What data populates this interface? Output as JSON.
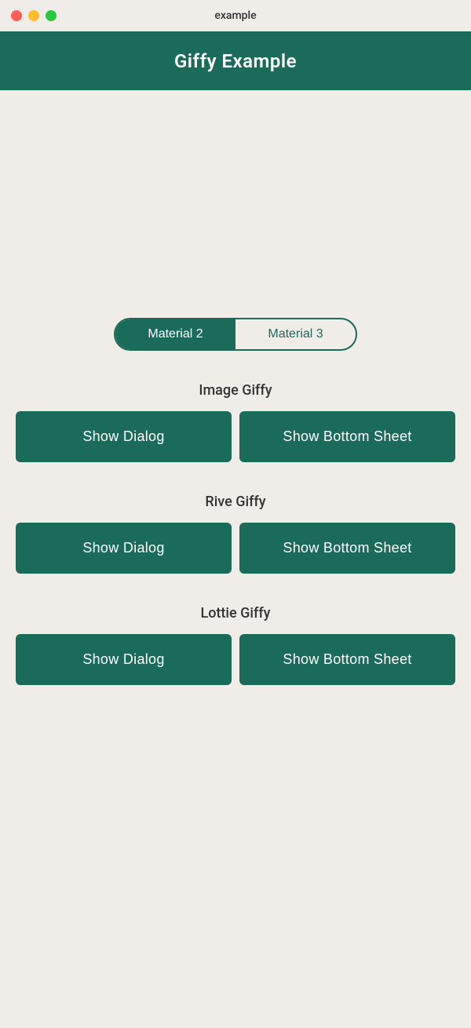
{
  "window": {
    "title": "example"
  },
  "header": {
    "title": "Giffy Example"
  },
  "tabs": [
    {
      "label": "Material 2",
      "active": true
    },
    {
      "label": "Material 3",
      "active": false
    }
  ],
  "sections": [
    {
      "title": "Image Giffy",
      "dialog_button": "Show Dialog",
      "sheet_button": "Show Bottom Sheet"
    },
    {
      "title": "Rive Giffy",
      "dialog_button": "Show Dialog",
      "sheet_button": "Show Bottom Sheet"
    },
    {
      "title": "Lottie Giffy",
      "dialog_button": "Show Dialog",
      "sheet_button": "Show Bottom Sheet"
    }
  ],
  "colors": {
    "primary": "#1a6b5a",
    "background": "#f0ece8",
    "tab_active_bg": "#1a6b5a",
    "tab_active_text": "#ffffff",
    "tab_inactive_text": "#1a6b5a"
  }
}
